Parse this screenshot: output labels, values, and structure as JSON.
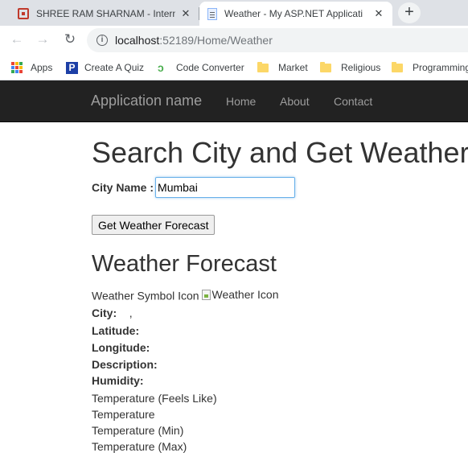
{
  "browser": {
    "tabs": [
      {
        "title": "SHREE RAM SHARNAM - Internat",
        "close": "✕"
      },
      {
        "title": "Weather - My ASP.NET Applicati",
        "close": "✕"
      }
    ],
    "new_tab": "+",
    "nav": {
      "back": "←",
      "forward": "→",
      "reload": "↻"
    },
    "address": {
      "host": "localhost",
      "path": ":52189/Home/Weather",
      "info": "i"
    },
    "bookmarks": {
      "apps": "Apps",
      "quiz": "Create A Quiz",
      "code": "Code Converter",
      "market": "Market",
      "religious": "Religious",
      "programming": "Programming"
    },
    "icons": {
      "quiz": "P",
      "code": "ↄ"
    },
    "apps_colors": [
      "#ea4335",
      "#fbbc05",
      "#34a853",
      "#4285f4",
      "#ea4335",
      "#fbbc05",
      "#34a853",
      "#4285f4",
      "#ea4335"
    ]
  },
  "site": {
    "brand": "Application name",
    "nav": [
      "Home",
      "About",
      "Contact"
    ]
  },
  "page": {
    "title": "Search City and Get Weather",
    "city_label": "City Name :",
    "city_value": "Mumbai",
    "button": "Get Weather Forecast",
    "forecast_title": "Weather Forecast",
    "symbol_label": "Weather Symbol Icon",
    "icon_alt": "Weather Icon",
    "city_key": "City:",
    "city_sep": ",",
    "latitude": "Latitude:",
    "longitude": "Longitude:",
    "description": "Description:",
    "humidity": "Humidity:",
    "temp_feels": "Temperature (Feels Like)",
    "temp": "Temperature",
    "temp_min": "Temperature (Min)",
    "temp_max": "Temperature (Max)"
  },
  "colors": {
    "navbar_bg": "#222222",
    "nav_text": "#9d9d9d",
    "input_focus": "#66afe9"
  }
}
